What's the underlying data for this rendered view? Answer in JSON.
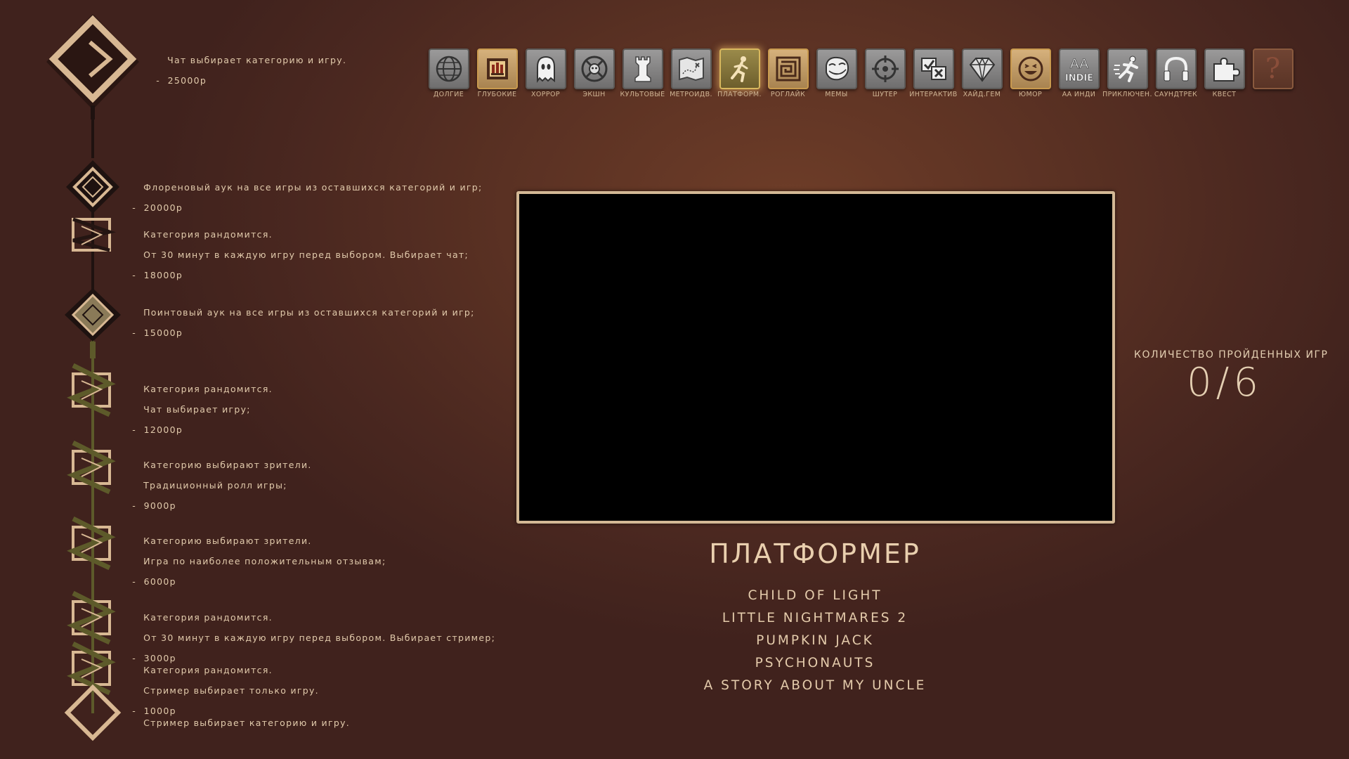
{
  "tiers": [
    {
      "lines": [
        "Чат выбирает категорию и игру."
      ],
      "price": " -  25000р"
    },
    {
      "lines": [
        "Флореновый аук на все игры из оставшихся категорий и игр;"
      ],
      "price": " -  20000р"
    },
    {
      "lines": [
        "Категория рандомится.",
        "От 30 минут в каждую игру перед выбором. Выбирает чат;"
      ],
      "price": " -  18000р"
    },
    {
      "lines": [
        "Поинтовый аук на все игры из оставшихся категорий и игр;"
      ],
      "price": " -  15000р"
    },
    {
      "lines": [
        "Категория рандомится.",
        "Чат выбирает игру;"
      ],
      "price": " -  12000р"
    },
    {
      "lines": [
        "Категорию выбирают зрители.",
        "Традиционный ролл игры;"
      ],
      "price": " -  9000р"
    },
    {
      "lines": [
        "Категорию выбирают зрители.",
        "Игра по наиболее положительным отзывам;"
      ],
      "price": " -  6000р"
    },
    {
      "lines": [
        "Категория рандомится.",
        "От 30 минут в каждую игру перед выбором. Выбирает стример;"
      ],
      "price": " -  3000р"
    },
    {
      "lines": [
        "Категория рандомится.",
        "Стример выбирает только игру."
      ],
      "price": " -  1000р"
    },
    {
      "lines": [
        "Стример выбирает категорию и игру."
      ],
      "price": ""
    }
  ],
  "categories": [
    {
      "label": "ДОЛГИЕ",
      "icon": "globe-icon",
      "state": "normal"
    },
    {
      "label": "ГЛУБОКИЕ",
      "icon": "pixel-castle-icon",
      "state": "gold"
    },
    {
      "label": "ХОРРОР",
      "icon": "ghost-icon",
      "state": "normal"
    },
    {
      "label": "ЭКШН",
      "icon": "crossed-swords-skull-icon",
      "state": "normal"
    },
    {
      "label": "КУЛЬТОВЫЕ",
      "icon": "chess-rook-icon",
      "state": "normal"
    },
    {
      "label": "МЕТРОИДВ.",
      "icon": "treasure-map-icon",
      "state": "normal"
    },
    {
      "label": "ПЛАТФОРМ.",
      "icon": "running-man-icon",
      "state": "active"
    },
    {
      "label": "РОГЛАЙК",
      "icon": "maze-icon",
      "state": "gold"
    },
    {
      "label": "МЕМЫ",
      "icon": "troll-face-icon",
      "state": "normal"
    },
    {
      "label": "ШУТЕР",
      "icon": "crosshair-icon",
      "state": "normal"
    },
    {
      "label": "ИНТЕРАКТИВ",
      "icon": "choice-boxes-icon",
      "state": "normal"
    },
    {
      "label": "ХАЙД.ГЕМ",
      "icon": "diamond-gem-icon",
      "state": "normal"
    },
    {
      "label": "ЮМОР",
      "icon": "laughing-face-icon",
      "state": "gold"
    },
    {
      "label": "АА ИНДИ",
      "icon": "aa-indie-icon",
      "state": "normal"
    },
    {
      "label": "ПРИКЛЮЧЕН.",
      "icon": "sprinting-figure-icon",
      "state": "normal"
    },
    {
      "label": "САУНДТРЕК",
      "icon": "headphones-icon",
      "state": "normal"
    },
    {
      "label": "КВЕСТ",
      "icon": "puzzle-piece-icon",
      "state": "normal"
    },
    {
      "label": "",
      "icon": "question-mark-icon",
      "state": "mystery"
    }
  ],
  "indie_icon_text": {
    "top": "AA",
    "bottom": "INDIE"
  },
  "mystery_glyph": "?",
  "counter": {
    "label": "КОЛИЧЕСТВО ПРОЙДЕННЫХ ИГР",
    "value": "0/6"
  },
  "category_title": "ПЛАТФОРМЕР",
  "games": [
    "CHILD OF LIGHT",
    "LITTLE NIGHTMARES 2",
    "PUMPKIN JACK",
    "PSYCHONAUTS",
    "A STORY ABOUT MY UNCLE"
  ]
}
